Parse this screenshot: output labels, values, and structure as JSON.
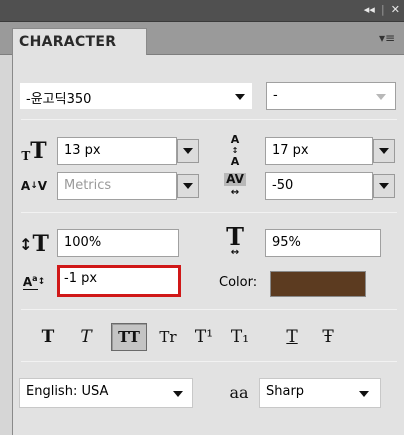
{
  "titlebar": {
    "collapse_icon": "double-chevron-left-icon",
    "close_icon": "close-icon"
  },
  "tab": {
    "label": "CHARACTER",
    "menu_icon": "panel-menu-icon"
  },
  "font_family": {
    "value": "-윤고딕350"
  },
  "font_style": {
    "value": "-"
  },
  "font_size": {
    "value": "13 px"
  },
  "leading": {
    "value": "17 px"
  },
  "kerning": {
    "value": "Metrics"
  },
  "tracking": {
    "value": "-50"
  },
  "vertical_scale": {
    "value": "100%"
  },
  "horizontal_scale": {
    "value": "95%"
  },
  "baseline_shift": {
    "value": "-1 px"
  },
  "color": {
    "label": "Color:",
    "swatch": "#5c3b20"
  },
  "text_styles": [
    "T",
    "T",
    "TT",
    "Tr",
    "T¹",
    "T₁",
    "T",
    "Ŧ"
  ],
  "language": {
    "value": "English: USA"
  },
  "antialias": {
    "icon_label": "aa",
    "value": "Sharp"
  },
  "colors": {
    "highlight": "#d01818",
    "panel_bg": "#e2e2e2"
  }
}
